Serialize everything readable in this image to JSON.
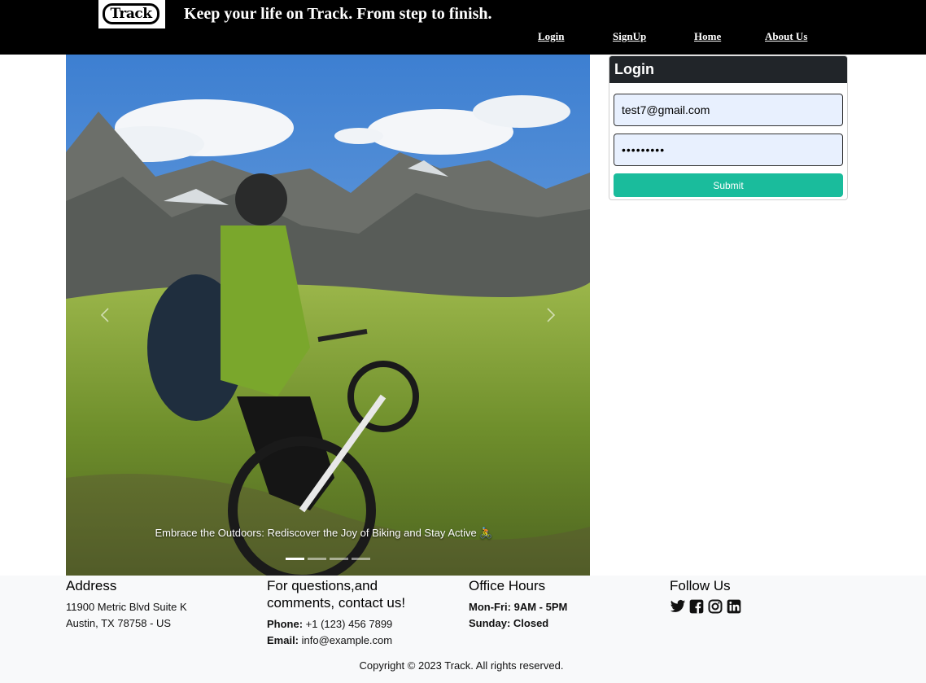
{
  "header": {
    "logo_text": "Track",
    "tagline": "Keep your life on Track. From step to finish.",
    "nav": {
      "login": "Login",
      "signup": "SignUp",
      "home": "Home",
      "about": "About Us"
    }
  },
  "carousel": {
    "caption": "Embrace the Outdoors: Rediscover the Joy of Biking and Stay Active 🚴",
    "slide_count": 4,
    "active_slide": 1
  },
  "login": {
    "title": "Login",
    "email_value": "test7@gmail.com",
    "password_value": "•••••••••",
    "submit_label": "Submit"
  },
  "footer": {
    "address": {
      "title": "Address",
      "line1": "11900 Metric Blvd Suite K",
      "line2": "Austin, TX 78758 - US"
    },
    "contact": {
      "title": "For questions,and comments, contact us!",
      "phone_label": "Phone:",
      "phone": " +1 (123) 456 7899",
      "email_label": "Email:",
      "email": " info@example.com"
    },
    "hours": {
      "title": "Office Hours",
      "weekday": "Mon-Fri: 9AM - 5PM",
      "sunday": "Sunday: Closed"
    },
    "follow": {
      "title": "Follow Us",
      "icons": [
        "twitter-icon",
        "facebook-icon",
        "instagram-icon",
        "linkedin-icon"
      ]
    },
    "copyright": "Copyright © 2023 Track. All rights reserved."
  },
  "colors": {
    "header_bg": "#000000",
    "submit_bg": "#1abc9c",
    "login_head_bg": "#212529",
    "footer_bg": "#f8f9fa"
  }
}
